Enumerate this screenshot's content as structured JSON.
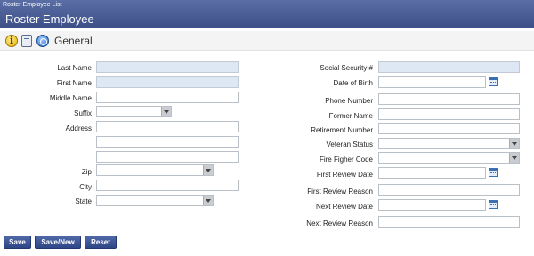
{
  "header": {
    "breadcrumb": "Roster Employee List",
    "title": "Roster Employee"
  },
  "toolbar": {
    "title": "General",
    "icons": [
      "info-icon",
      "document-icon",
      "award-icon"
    ]
  },
  "left_fields": {
    "last_name": {
      "label": "Last Name",
      "value": ""
    },
    "first_name": {
      "label": "First Name",
      "value": ""
    },
    "middle_name": {
      "label": "Middle Name",
      "value": ""
    },
    "suffix": {
      "label": "Suffix",
      "value": ""
    },
    "address": {
      "label": "Address",
      "value": ""
    },
    "zip": {
      "label": "Zip",
      "value": ""
    },
    "city": {
      "label": "City",
      "value": ""
    },
    "state": {
      "label": "State",
      "value": ""
    }
  },
  "right_fields": {
    "ssn": {
      "label": "Social Security #",
      "value": ""
    },
    "dob": {
      "label": "Date of Birth",
      "value": ""
    },
    "phone": {
      "label": "Phone Number",
      "value": ""
    },
    "former_name": {
      "label": "Former Name",
      "value": ""
    },
    "retirement_number": {
      "label": "Retirement Number",
      "value": ""
    },
    "veteran_status": {
      "label": "Veteran Status",
      "value": ""
    },
    "fire_fighter_code": {
      "label": "Fire Figher Code",
      "value": ""
    },
    "first_review_date": {
      "label": "First Review Date",
      "value": ""
    },
    "first_review_reason": {
      "label": "First Review Reason",
      "value": ""
    },
    "next_review_date": {
      "label": "Next Review Date",
      "value": ""
    },
    "next_review_reason": {
      "label": "Next Review Reason",
      "value": ""
    }
  },
  "buttons": {
    "save": "Save",
    "save_new": "Save/New",
    "reset": "Reset"
  },
  "colors": {
    "header_bg": "#3d5088",
    "button_bg": "#2f4686",
    "readonly_field": "#dde8f4"
  }
}
